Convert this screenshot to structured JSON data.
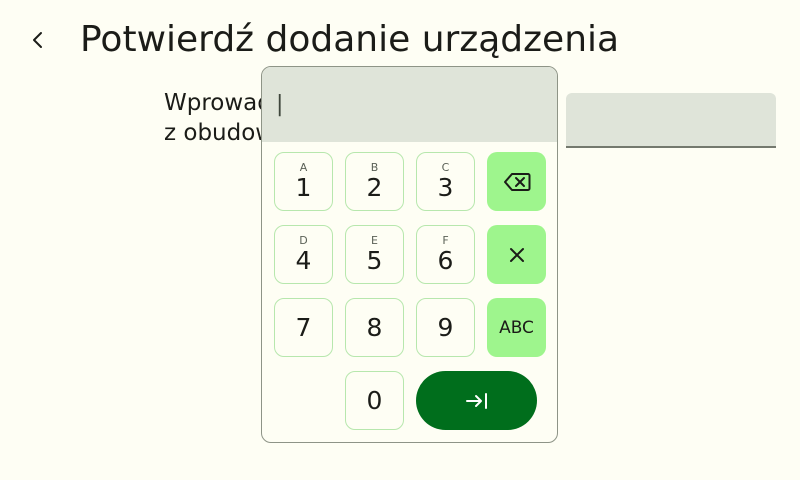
{
  "header": {
    "title": "Potwierdź dodanie urządzenia"
  },
  "instruction": {
    "line1": "Wprowadź kod PIN",
    "line2": "z obudowy urządzenia"
  },
  "keypad": {
    "display_value": "|",
    "keys": {
      "k1": {
        "num": "1",
        "sub": "A"
      },
      "k2": {
        "num": "2",
        "sub": "B"
      },
      "k3": {
        "num": "3",
        "sub": "C"
      },
      "k4": {
        "num": "4",
        "sub": "D"
      },
      "k5": {
        "num": "5",
        "sub": "E"
      },
      "k6": {
        "num": "6",
        "sub": "F"
      },
      "k7": {
        "num": "7"
      },
      "k8": {
        "num": "8"
      },
      "k9": {
        "num": "9"
      },
      "k0": {
        "num": "0"
      }
    },
    "abc_label": "ABC"
  },
  "icons": {
    "back": "chevron-left-icon",
    "backspace": "backspace-icon",
    "clear": "close-icon",
    "enter": "tab-next-icon"
  },
  "colors": {
    "background": "#fefef4",
    "field": "#dfe4d9",
    "action_key": "#9ef58d",
    "enter_key": "#006e1c",
    "key_border": "#b7e7ad"
  }
}
